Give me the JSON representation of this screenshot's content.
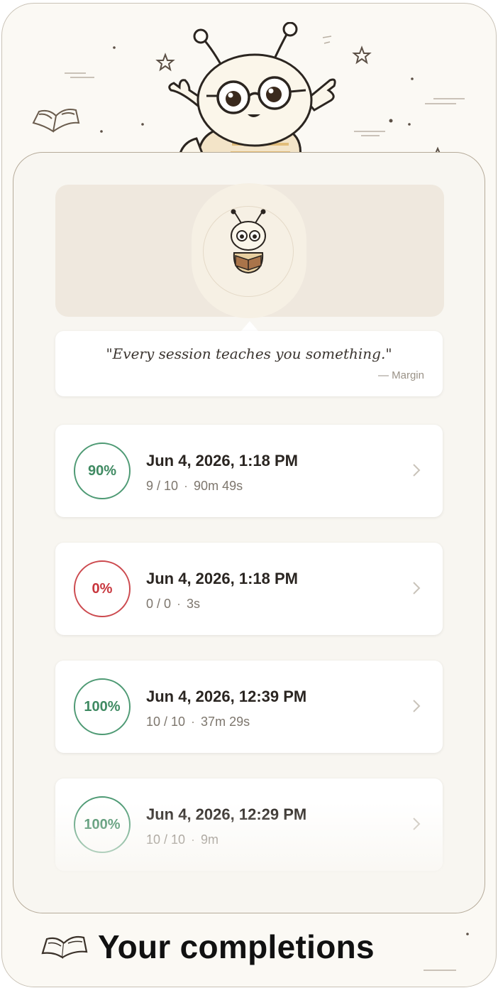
{
  "quote": {
    "text": "\"Every session teaches you something.\"",
    "author": "— Margin"
  },
  "sessions": [
    {
      "score": "90%",
      "status": "good",
      "date": "Jun 4, 2026, 1:18 PM",
      "correct": "9 / 10",
      "separator": "·",
      "duration": "90m 49s"
    },
    {
      "score": "0%",
      "status": "bad",
      "date": "Jun 4, 2026, 1:18 PM",
      "correct": "0 / 0",
      "separator": "·",
      "duration": "3s"
    },
    {
      "score": "100%",
      "status": "good",
      "date": "Jun 4, 2026, 12:39 PM",
      "correct": "10 / 10",
      "separator": "·",
      "duration": "37m 29s"
    },
    {
      "score": "100%",
      "status": "good",
      "date": "Jun 4, 2026, 12:29 PM",
      "correct": "10 / 10",
      "separator": "·",
      "duration": "9m"
    }
  ],
  "caption": "Your completions",
  "colors": {
    "good": "#4e9a74",
    "bad": "#cc4a4f",
    "background": "#fbf9f4"
  },
  "icons": [
    "mascot-bee-illustration",
    "book-icon",
    "star-icon",
    "chevron-right-icon"
  ]
}
